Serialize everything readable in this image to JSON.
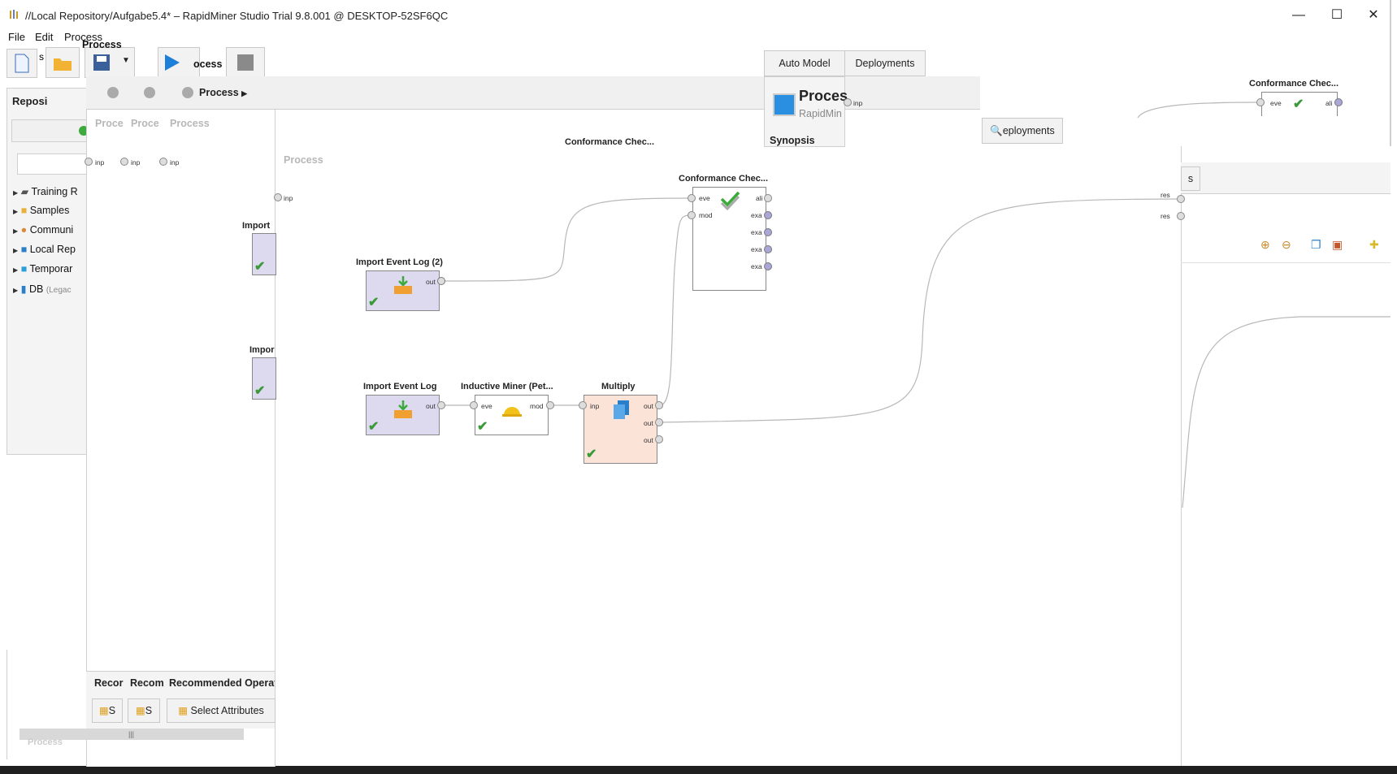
{
  "window": {
    "title": "//Local Repository/Aufgabe5.4* – RapidMiner Studio Trial 9.8.001 @ DESKTOP-52SF6QC",
    "minimize": "—",
    "maximize": "☐",
    "close": "✕"
  },
  "menu": {
    "file": "File",
    "edit": "Edit",
    "process": "Process"
  },
  "toolbar": {
    "auto_model": "Auto Model",
    "deployments": "Deployments",
    "deployments2": "eployments",
    "process_tab": "Process",
    "process_tab2": "ocess",
    "s_tab": "s"
  },
  "repository": {
    "title": "Reposi",
    "items": [
      {
        "label": "Training R"
      },
      {
        "label": "Samples"
      },
      {
        "label": "Communi"
      },
      {
        "label": "Local Rep"
      },
      {
        "label": "Temporar"
      },
      {
        "label": "DB",
        "suffix": "(Legac"
      }
    ]
  },
  "breadcrumb": {
    "process": "Process"
  },
  "ghost": {
    "proc1": "Proce",
    "proc2": "Proce",
    "proc3": "Process",
    "proc4": "Process",
    "inp": "inp",
    "import1": "Import",
    "import2": "Impor",
    "conf_ghost": "Conformance Chec...",
    "conf_right": "Conformance Chec...",
    "eve": "eve",
    "ali": "ali",
    "res": "res",
    "process_bottom": "Process"
  },
  "process_info": {
    "title": "Proces",
    "subtitle": "RapidMin",
    "synopsis": "Synopsis"
  },
  "operators": {
    "import2": {
      "title": "Import Event Log (2)",
      "out": "out"
    },
    "import1": {
      "title": "Import Event Log",
      "out": "out"
    },
    "miner": {
      "title": "Inductive Miner (Pet...",
      "eve": "eve",
      "mod": "mod"
    },
    "multiply": {
      "title": "Multiply",
      "inp": "inp",
      "out": "out"
    },
    "conformance": {
      "title": "Conformance Chec...",
      "eve": "eve",
      "mod": "mod",
      "ali": "ali",
      "exa": "exa"
    }
  },
  "recommended": {
    "short": "Recor",
    "short2": "Recom",
    "title": "Recommended Operat",
    "item_short": "S",
    "item": "Select Attributes"
  }
}
